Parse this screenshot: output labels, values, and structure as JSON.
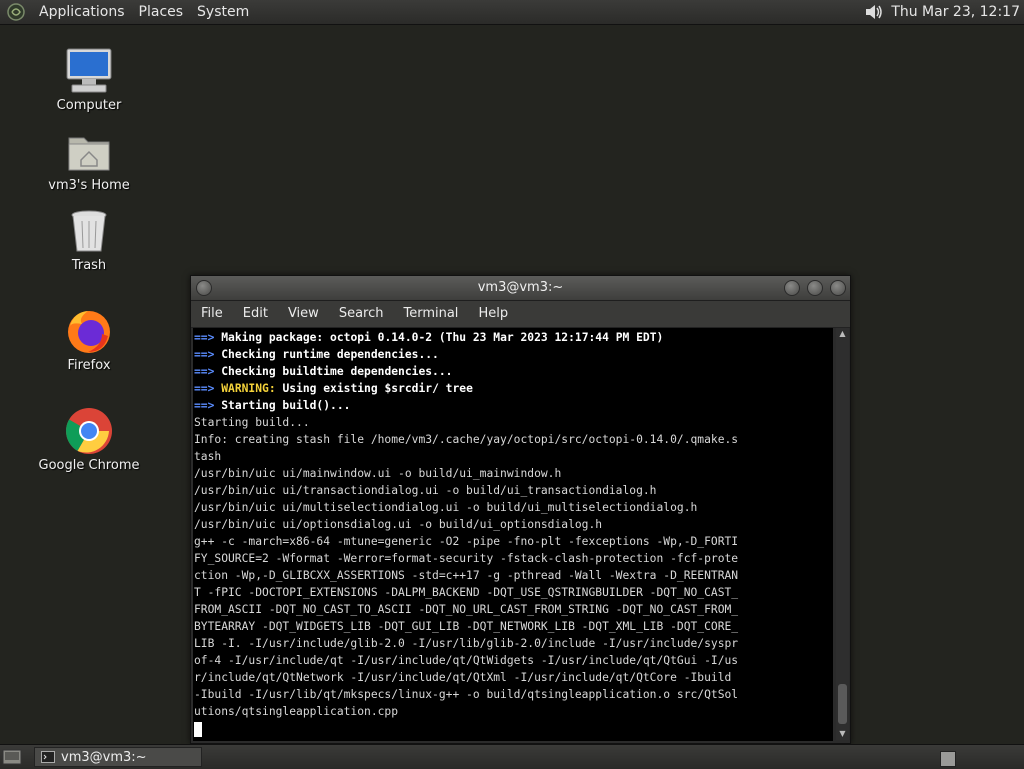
{
  "top_panel": {
    "menus": [
      "Applications",
      "Places",
      "System"
    ],
    "clock": "Thu Mar 23, 12:17",
    "volume_icon": "speaker-icon"
  },
  "desktop": {
    "icons": [
      {
        "label": "Computer",
        "icon": "computer-icon"
      },
      {
        "label": "vm3's Home",
        "icon": "home-folder-icon"
      },
      {
        "label": "Trash",
        "icon": "trash-icon"
      },
      {
        "label": "Firefox",
        "icon": "firefox-icon"
      },
      {
        "label": "Google Chrome",
        "icon": "chrome-icon"
      }
    ]
  },
  "terminal": {
    "title": "vm3@vm3:~",
    "menu": [
      "File",
      "Edit",
      "View",
      "Search",
      "Terminal",
      "Help"
    ],
    "lines": [
      {
        "arrow": "==> ",
        "bold": "Making package: octopi 0.14.0-2 (Thu 23 Mar 2023 12:17:44 PM EDT)"
      },
      {
        "arrow": "==> ",
        "bold": "Checking runtime dependencies..."
      },
      {
        "arrow": "==> ",
        "bold": "Checking buildtime dependencies..."
      },
      {
        "arrow": "==> ",
        "warn": "WARNING:",
        "bold": " Using existing $srcdir/ tree"
      },
      {
        "arrow": "==> ",
        "bold": "Starting build()..."
      },
      {
        "text": "Starting build..."
      },
      {
        "text": "Info: creating stash file /home/vm3/.cache/yay/octopi/src/octopi-0.14.0/.qmake.s"
      },
      {
        "text": "tash"
      },
      {
        "text": "/usr/bin/uic ui/mainwindow.ui -o build/ui_mainwindow.h"
      },
      {
        "text": "/usr/bin/uic ui/transactiondialog.ui -o build/ui_transactiondialog.h"
      },
      {
        "text": "/usr/bin/uic ui/multiselectiondialog.ui -o build/ui_multiselectiondialog.h"
      },
      {
        "text": "/usr/bin/uic ui/optionsdialog.ui -o build/ui_optionsdialog.h"
      },
      {
        "text": "g++ -c -march=x86-64 -mtune=generic -O2 -pipe -fno-plt -fexceptions -Wp,-D_FORTI"
      },
      {
        "text": "FY_SOURCE=2 -Wformat -Werror=format-security -fstack-clash-protection -fcf-prote"
      },
      {
        "text": "ction -Wp,-D_GLIBCXX_ASSERTIONS -std=c++17 -g -pthread -Wall -Wextra -D_REENTRAN"
      },
      {
        "text": "T -fPIC -DOCTOPI_EXTENSIONS -DALPM_BACKEND -DQT_USE_QSTRINGBUILDER -DQT_NO_CAST_"
      },
      {
        "text": "FROM_ASCII -DQT_NO_CAST_TO_ASCII -DQT_NO_URL_CAST_FROM_STRING -DQT_NO_CAST_FROM_"
      },
      {
        "text": "BYTEARRAY -DQT_WIDGETS_LIB -DQT_GUI_LIB -DQT_NETWORK_LIB -DQT_XML_LIB -DQT_CORE_"
      },
      {
        "text": "LIB -I. -I/usr/include/glib-2.0 -I/usr/lib/glib-2.0/include -I/usr/include/syspr"
      },
      {
        "text": "of-4 -I/usr/include/qt -I/usr/include/qt/QtWidgets -I/usr/include/qt/QtGui -I/us"
      },
      {
        "text": "r/include/qt/QtNetwork -I/usr/include/qt/QtXml -I/usr/include/qt/QtCore -Ibuild"
      },
      {
        "text": "-Ibuild -I/usr/lib/qt/mkspecs/linux-g++ -o build/qtsingleapplication.o src/QtSol"
      },
      {
        "text": "utions/qtsingleapplication.cpp"
      },
      {
        "text": ""
      }
    ]
  },
  "bottom_panel": {
    "task_label": "vm3@vm3:~"
  },
  "colors": {
    "desktop_bg": "#23241f",
    "prompt_arrow": "#5b8dff",
    "warning": "#f4d23a"
  }
}
